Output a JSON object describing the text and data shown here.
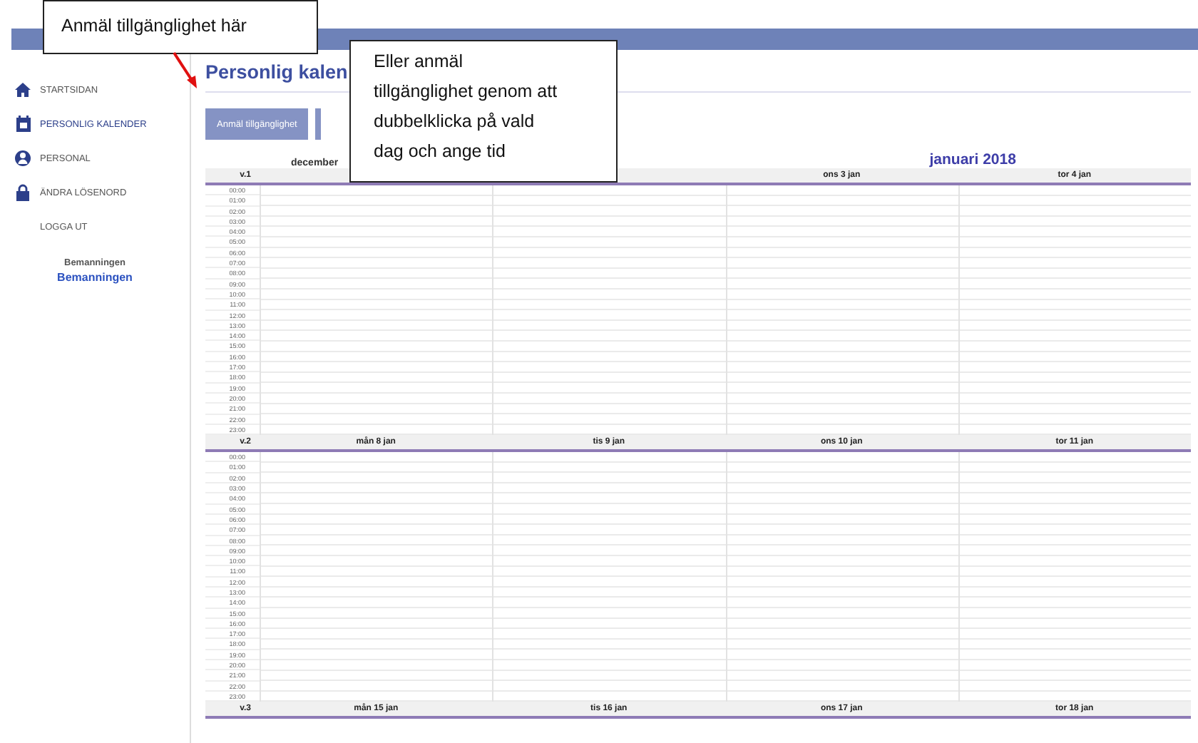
{
  "sidebar": {
    "items": [
      {
        "label": "STARTSIDAN",
        "selected": false
      },
      {
        "label": "PERSONLIG KALENDER",
        "selected": true
      },
      {
        "label": "PERSONAL",
        "selected": false
      },
      {
        "label": "ÄNDRA LÖSENORD",
        "selected": false
      },
      {
        "label": "LOGGA UT",
        "selected": false
      }
    ],
    "group_label": "Bemanningen",
    "group_link": "Bemanningen"
  },
  "page_title": "Personlig kalen",
  "buttons": [
    "Anmäl tillgänglighet"
  ],
  "months": [
    "december",
    "januari 2018"
  ],
  "weeks": [
    {
      "week": "v.1",
      "days": [
        "ons 3 jan",
        "tor 4 jan"
      ],
      "times": [
        "00:00",
        "01:00",
        "02:00",
        "03:00",
        "04:00",
        "05:00",
        "06:00",
        "07:00",
        "08:00",
        "09:00",
        "10:00",
        "11:00",
        "12:00",
        "13:00",
        "14:00",
        "15:00",
        "16:00",
        "17:00",
        "18:00",
        "19:00",
        "20:00",
        "21:00",
        "22:00",
        "23:00"
      ]
    },
    {
      "week": "v.2",
      "days": [
        "mån 8 jan",
        "tis 9 jan",
        "ons 10 jan",
        "tor 11 jan"
      ],
      "times": [
        "00:00",
        "01:00",
        "02:00",
        "03:00",
        "04:00",
        "05:00",
        "06:00",
        "07:00",
        "08:00",
        "09:00",
        "10:00",
        "11:00",
        "12:00",
        "13:00",
        "14:00",
        "15:00",
        "16:00",
        "17:00",
        "18:00",
        "19:00",
        "20:00",
        "21:00",
        "22:00",
        "23:00"
      ]
    },
    {
      "week": "v.3",
      "days": [
        "mån 15 jan",
        "tis 16 jan",
        "ons 17 jan",
        "tor 18 jan"
      ]
    }
  ],
  "callouts": [
    "Anmäl tillgänglighet här",
    "Eller anmäl tillgänglighet genom att dubbelklicka på vald dag och ange tid"
  ]
}
